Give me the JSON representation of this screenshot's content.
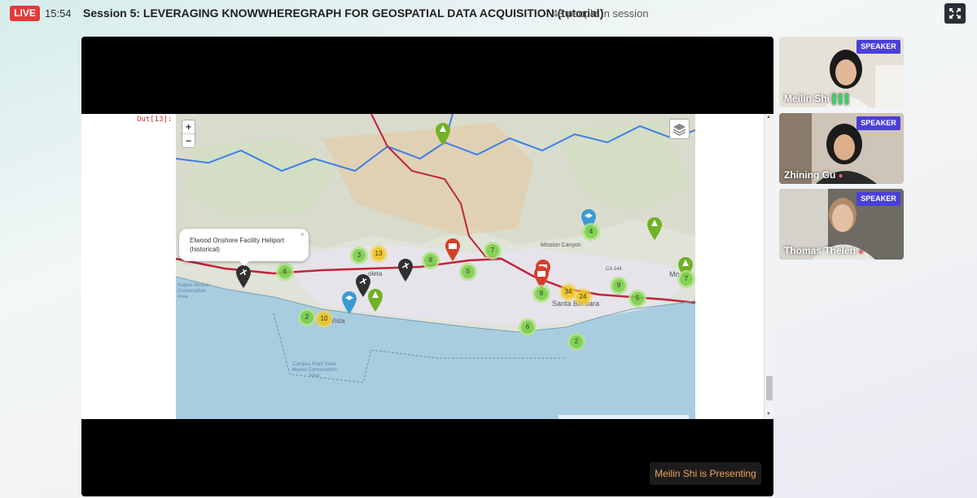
{
  "header": {
    "live_label": "LIVE",
    "time": "15:54",
    "session_title": "Session 5: LEVERAGING KNOWWHEREGRAPH FOR GEOSPATIAL DATA ACQUISITION (tutorial)",
    "people_count": "43 people in session"
  },
  "notebook": {
    "out_label": "Out[13]:"
  },
  "map": {
    "zoom_in": "+",
    "zoom_out": "−",
    "popup_text": "Elwood Onshore Facility Heliport (historical)",
    "popup_close": "×",
    "clusters": [
      {
        "label": "6",
        "color": "green"
      },
      {
        "label": "3",
        "color": "green"
      },
      {
        "label": "13",
        "color": "yellow"
      },
      {
        "label": "8",
        "color": "green"
      },
      {
        "label": "5",
        "color": "green"
      },
      {
        "label": "7",
        "color": "green"
      },
      {
        "label": "4",
        "color": "green"
      },
      {
        "label": "8",
        "color": "green"
      },
      {
        "label": "34",
        "color": "yellow"
      },
      {
        "label": "24",
        "color": "yellow"
      },
      {
        "label": "9",
        "color": "green"
      },
      {
        "label": "5",
        "color": "green"
      },
      {
        "label": "7",
        "color": "green"
      },
      {
        "label": "2",
        "color": "green"
      },
      {
        "label": "10",
        "color": "yellow"
      },
      {
        "label": "6",
        "color": "green"
      },
      {
        "label": "2",
        "color": "green"
      }
    ],
    "place_labels": {
      "marine_area": "Campus Point State Marine Conservation Area",
      "naples": "Naples Marine Conservation Area",
      "santa_barbara": "Santa Barbara",
      "montecito": "Mo",
      "mission_canyon": "Mission Canyon",
      "goleta": "oleta",
      "vista": "Vista",
      "ca144": "CA 144"
    }
  },
  "presenting_label": "Meilin Shi is Presenting",
  "speakers": [
    {
      "tag": "SPEAKER",
      "name": "Meilin Shi"
    },
    {
      "tag": "SPEAKER",
      "name": "Zhining Gu"
    },
    {
      "tag": "SPEAKER",
      "name": "Thomas Thelen"
    }
  ],
  "colors": {
    "live": "#e23a3a",
    "speaker_tag": "#4a3fd8",
    "presenting_text": "#f0a35c"
  }
}
